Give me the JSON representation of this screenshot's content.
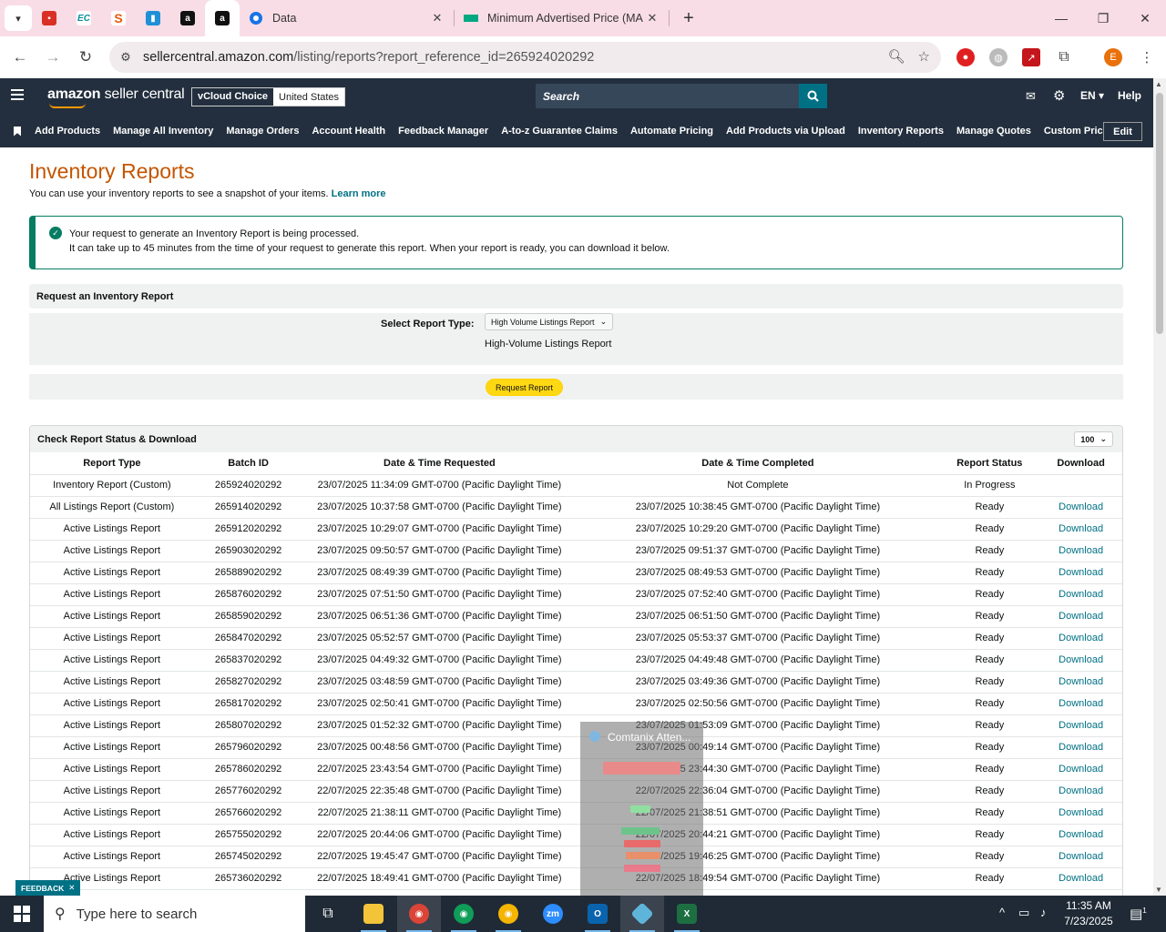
{
  "browser": {
    "tabs": [
      {
        "title": "Data",
        "active": false
      },
      {
        "title": "Minimum Advertised Price (MA",
        "active": false
      }
    ],
    "url_host": "sellercentral.amazon.com",
    "url_path": "/listing/reports?report_reference_id=265924020292",
    "profile_initial": "E"
  },
  "header": {
    "logo_main": "amazon",
    "logo_sub": "seller central",
    "store_name": "vCloud Choice",
    "marketplace": "United States",
    "search_placeholder": "Search",
    "language": "EN",
    "help": "Help"
  },
  "nav": {
    "items": [
      "Add Products",
      "Manage All Inventory",
      "Manage Orders",
      "Account Health",
      "Feedback Manager",
      "A-to-z Guarantee Claims",
      "Automate Pricing",
      "Add Products via Upload",
      "Inventory Reports",
      "Manage Quotes",
      "Custom Pricing"
    ],
    "edit_label": "Edit"
  },
  "page": {
    "title": "Inventory Reports",
    "subtitle": "You can use your inventory reports to see a snapshot of your items.",
    "learn_more": "Learn more",
    "alert_line1": "Your request to generate an Inventory Report is being processed.",
    "alert_line2": "It can take up to 45 minutes from the time of your request to generate this report. When your report is ready, you can download it below."
  },
  "request": {
    "heading": "Request an Inventory Report",
    "select_label": "Select Report Type:",
    "selected_type": "High Volume Listings Report",
    "description": "High-Volume Listings Report",
    "button": "Request Report"
  },
  "status": {
    "heading": "Check Report Status & Download",
    "per_page": "100",
    "columns": [
      "Report Type",
      "Batch ID",
      "Date & Time Requested",
      "Date & Time Completed",
      "Report Status",
      "Download"
    ],
    "rows": [
      [
        "Inventory Report (Custom)",
        "265924020292",
        "23/07/2025 11:34:09 GMT-0700 (Pacific Daylight Time)",
        "Not Complete",
        "In Progress",
        ""
      ],
      [
        "All Listings Report (Custom)",
        "265914020292",
        "23/07/2025 10:37:58 GMT-0700 (Pacific Daylight Time)",
        "23/07/2025 10:38:45 GMT-0700 (Pacific Daylight Time)",
        "Ready",
        "Download"
      ],
      [
        "Active Listings Report",
        "265912020292",
        "23/07/2025 10:29:07 GMT-0700 (Pacific Daylight Time)",
        "23/07/2025 10:29:20 GMT-0700 (Pacific Daylight Time)",
        "Ready",
        "Download"
      ],
      [
        "Active Listings Report",
        "265903020292",
        "23/07/2025 09:50:57 GMT-0700 (Pacific Daylight Time)",
        "23/07/2025 09:51:37 GMT-0700 (Pacific Daylight Time)",
        "Ready",
        "Download"
      ],
      [
        "Active Listings Report",
        "265889020292",
        "23/07/2025 08:49:39 GMT-0700 (Pacific Daylight Time)",
        "23/07/2025 08:49:53 GMT-0700 (Pacific Daylight Time)",
        "Ready",
        "Download"
      ],
      [
        "Active Listings Report",
        "265876020292",
        "23/07/2025 07:51:50 GMT-0700 (Pacific Daylight Time)",
        "23/07/2025 07:52:40 GMT-0700 (Pacific Daylight Time)",
        "Ready",
        "Download"
      ],
      [
        "Active Listings Report",
        "265859020292",
        "23/07/2025 06:51:36 GMT-0700 (Pacific Daylight Time)",
        "23/07/2025 06:51:50 GMT-0700 (Pacific Daylight Time)",
        "Ready",
        "Download"
      ],
      [
        "Active Listings Report",
        "265847020292",
        "23/07/2025 05:52:57 GMT-0700 (Pacific Daylight Time)",
        "23/07/2025 05:53:37 GMT-0700 (Pacific Daylight Time)",
        "Ready",
        "Download"
      ],
      [
        "Active Listings Report",
        "265837020292",
        "23/07/2025 04:49:32 GMT-0700 (Pacific Daylight Time)",
        "23/07/2025 04:49:48 GMT-0700 (Pacific Daylight Time)",
        "Ready",
        "Download"
      ],
      [
        "Active Listings Report",
        "265827020292",
        "23/07/2025 03:48:59 GMT-0700 (Pacific Daylight Time)",
        "23/07/2025 03:49:36 GMT-0700 (Pacific Daylight Time)",
        "Ready",
        "Download"
      ],
      [
        "Active Listings Report",
        "265817020292",
        "23/07/2025 02:50:41 GMT-0700 (Pacific Daylight Time)",
        "23/07/2025 02:50:56 GMT-0700 (Pacific Daylight Time)",
        "Ready",
        "Download"
      ],
      [
        "Active Listings Report",
        "265807020292",
        "23/07/2025 01:52:32 GMT-0700 (Pacific Daylight Time)",
        "23/07/2025 01:53:09 GMT-0700 (Pacific Daylight Time)",
        "Ready",
        "Download"
      ],
      [
        "Active Listings Report",
        "265796020292",
        "23/07/2025 00:48:56 GMT-0700 (Pacific Daylight Time)",
        "23/07/2025 00:49:14 GMT-0700 (Pacific Daylight Time)",
        "Ready",
        "Download"
      ],
      [
        "Active Listings Report",
        "265786020292",
        "22/07/2025 23:43:54 GMT-0700 (Pacific Daylight Time)",
        "22/07/2025 23:44:30 GMT-0700 (Pacific Daylight Time)",
        "Ready",
        "Download"
      ],
      [
        "Active Listings Report",
        "265776020292",
        "22/07/2025 22:35:48 GMT-0700 (Pacific Daylight Time)",
        "22/07/2025 22:36:04 GMT-0700 (Pacific Daylight Time)",
        "Ready",
        "Download"
      ],
      [
        "Active Listings Report",
        "265766020292",
        "22/07/2025 21:38:11 GMT-0700 (Pacific Daylight Time)",
        "22/07/2025 21:38:51 GMT-0700 (Pacific Daylight Time)",
        "Ready",
        "Download"
      ],
      [
        "Active Listings Report",
        "265755020292",
        "22/07/2025 20:44:06 GMT-0700 (Pacific Daylight Time)",
        "22/07/2025 20:44:21 GMT-0700 (Pacific Daylight Time)",
        "Ready",
        "Download"
      ],
      [
        "Active Listings Report",
        "265745020292",
        "22/07/2025 19:45:47 GMT-0700 (Pacific Daylight Time)",
        "22/07/2025 19:46:25 GMT-0700 (Pacific Daylight Time)",
        "Ready",
        "Download"
      ],
      [
        "Active Listings Report",
        "265736020292",
        "22/07/2025 18:49:41 GMT-0700 (Pacific Daylight Time)",
        "22/07/2025 18:49:54 GMT-0700 (Pacific Daylight Time)",
        "Ready",
        "Download"
      ]
    ]
  },
  "feedback_label": "FEEDBACK",
  "overlay_title": "Comtanix Atten...",
  "taskbar": {
    "search_placeholder": "Type here to search",
    "time": "11:35 AM",
    "date": "7/23/2025",
    "notification_count": "1"
  },
  "colors": {
    "header_bg": "#232f3e",
    "title_orange": "#c45500",
    "link_teal": "#007185",
    "success_green": "#067d62",
    "button_yellow": "#ffd814",
    "tabstrip_pink": "#f9dde6"
  }
}
